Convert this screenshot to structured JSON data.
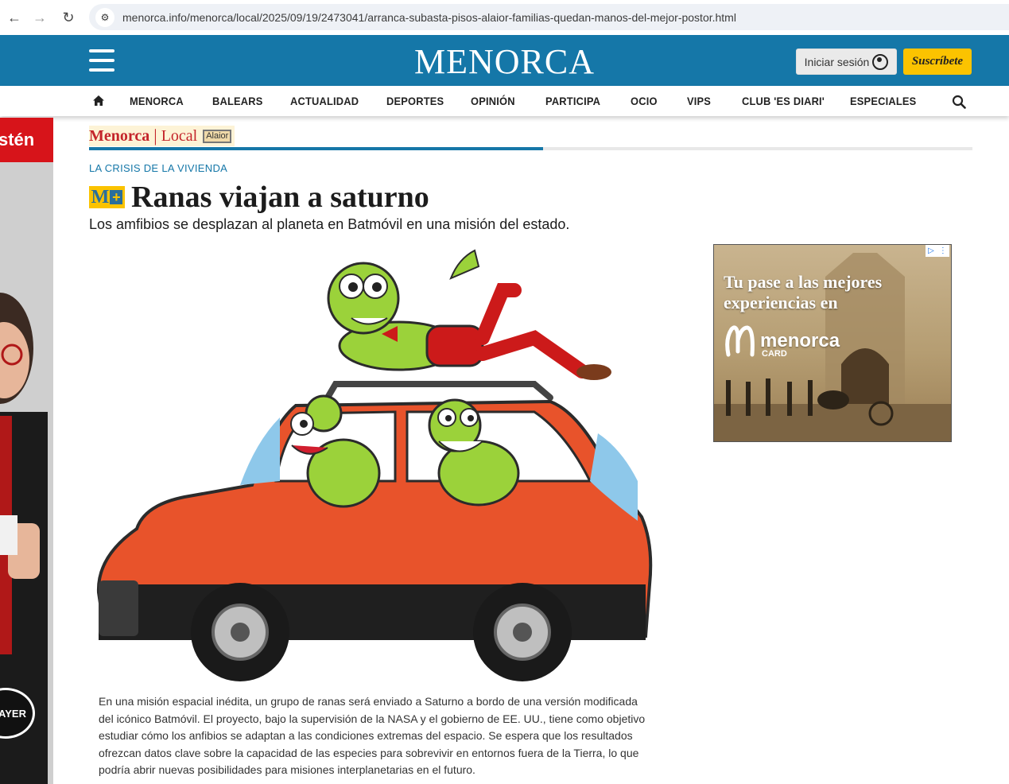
{
  "browser": {
    "url": "menorca.info/menorca/local/2025/09/19/2473041/arranca-subasta-pisos-alaior-familias-quedan-manos-del-mejor-postor.html"
  },
  "header": {
    "brand": "MENORCA",
    "login_label": "Iniciar sesión",
    "subscribe_label": "Suscríbete",
    "accent_color": "#1577a8"
  },
  "nav": {
    "items": [
      {
        "label": "MENORCA",
        "active": true
      },
      {
        "label": "BALEARS",
        "active": false
      },
      {
        "label": "ACTUALIDAD",
        "active": false
      },
      {
        "label": "DEPORTES",
        "active": false
      },
      {
        "label": "OPINIÓN",
        "active": false
      },
      {
        "label": "PARTICIPA",
        "active": false
      },
      {
        "label": "OCIO",
        "active": false
      },
      {
        "label": "VIPS",
        "active": false
      },
      {
        "label": "CLUB 'ES DIARI'",
        "active": false
      },
      {
        "label": "ESPECIALES",
        "active": false
      }
    ]
  },
  "left_ad": {
    "word": "stén",
    "brand": "BAYER"
  },
  "breadcrumb": {
    "section": "Menorca",
    "subsection": "Local",
    "tag": "Alaior"
  },
  "reading_progress": 0.514,
  "article": {
    "kicker": "LA CRISIS DE LA VIVIENDA",
    "badge": "M+",
    "headline": "Ranas viajan a saturno",
    "subtitle": "Los amfibios se desplazan al planeta en Batmóvil en una misión del estado.",
    "body": "En una misión espacial inédita, un grupo de ranas será enviado a Saturno a bordo de una versión modificada del icónico Batmóvil. El proyecto, bajo la supervisión de la NASA y el gobierno de EE. UU., tiene como objetivo estudiar cómo los anfibios se adaptan a las condiciones extremas del espacio. Se espera que los resultados ofrezcan datos clave sobre la capacidad de las especies para sobrevivir en entornos fuera de la Tierra, lo que podría abrir nuevas posibilidades para misiones interplanetarias en el futuro."
  },
  "right_ad": {
    "text": "Tu pase a las mejores experiencias en",
    "logo_word": "menorca",
    "logo_sub": "CARD"
  }
}
